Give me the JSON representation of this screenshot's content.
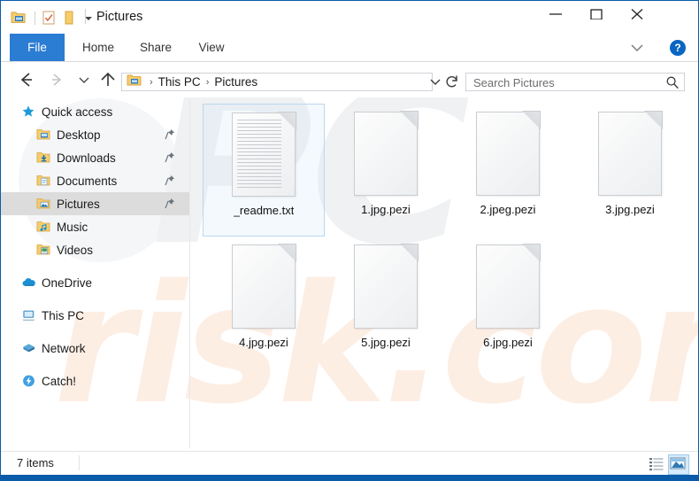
{
  "window": {
    "title": "Pictures",
    "quick_access_icons": [
      "folder-properties-icon",
      "properties-checkbox-icon",
      "new-folder-icon"
    ],
    "customize_qat_label": "Customize Quick Access Toolbar",
    "controls": {
      "minimize": "minimize-button",
      "maximize": "maximize-button",
      "close": "close-button"
    },
    "accent_color": "#0a5ca8",
    "file_tab_color": "#2b7cd3"
  },
  "ribbon": {
    "tabs": [
      {
        "label": "File",
        "active": true
      },
      {
        "label": "Home",
        "active": false
      },
      {
        "label": "Share",
        "active": false
      },
      {
        "label": "View",
        "active": false
      }
    ],
    "expand_label": "Expand Ribbon",
    "help_label": "?"
  },
  "address": {
    "back_label": "Back",
    "forward_label": "Forward",
    "recent_label": "Recent locations",
    "up_label": "Up one level",
    "breadcrumbs": [
      "This PC",
      "Pictures"
    ],
    "separator": "›",
    "dropdown_label": "Previous locations",
    "refresh_label": "Refresh",
    "search": {
      "placeholder": "Search Pictures",
      "value": ""
    }
  },
  "sidebar": {
    "items": [
      {
        "label": "Quick access",
        "icon": "star-icon",
        "indent": 0,
        "pinned": false,
        "selected": false,
        "gap_before": false
      },
      {
        "label": "Desktop",
        "icon": "folder-desktop-icon",
        "indent": 1,
        "pinned": true,
        "selected": false,
        "gap_before": false
      },
      {
        "label": "Downloads",
        "icon": "folder-downloads-icon",
        "indent": 1,
        "pinned": true,
        "selected": false,
        "gap_before": false
      },
      {
        "label": "Documents",
        "icon": "folder-documents-icon",
        "indent": 1,
        "pinned": true,
        "selected": false,
        "gap_before": false
      },
      {
        "label": "Pictures",
        "icon": "folder-pictures-icon",
        "indent": 1,
        "pinned": true,
        "selected": true,
        "gap_before": false
      },
      {
        "label": "Music",
        "icon": "folder-music-icon",
        "indent": 1,
        "pinned": false,
        "selected": false,
        "gap_before": false
      },
      {
        "label": "Videos",
        "icon": "folder-videos-icon",
        "indent": 1,
        "pinned": false,
        "selected": false,
        "gap_before": false
      },
      {
        "label": "OneDrive",
        "icon": "cloud-icon",
        "indent": 0,
        "pinned": false,
        "selected": false,
        "gap_before": true
      },
      {
        "label": "This PC",
        "icon": "computer-icon",
        "indent": 0,
        "pinned": false,
        "selected": false,
        "gap_before": true
      },
      {
        "label": "Network",
        "icon": "network-icon",
        "indent": 0,
        "pinned": false,
        "selected": false,
        "gap_before": true
      },
      {
        "label": "Catch!",
        "icon": "catch-icon",
        "indent": 0,
        "pinned": false,
        "selected": false,
        "gap_before": true
      }
    ]
  },
  "files": [
    {
      "name": "_readme.txt",
      "type": "text-document",
      "selected": true
    },
    {
      "name": "1.jpg.pezi",
      "type": "blank-document",
      "selected": false
    },
    {
      "name": "2.jpeg.pezi",
      "type": "blank-document",
      "selected": false
    },
    {
      "name": "3.jpg.pezi",
      "type": "blank-document",
      "selected": false
    },
    {
      "name": "4.jpg.pezi",
      "type": "blank-document",
      "selected": false
    },
    {
      "name": "5.jpg.pezi",
      "type": "blank-document",
      "selected": false
    },
    {
      "name": "6.jpg.pezi",
      "type": "blank-document",
      "selected": false
    }
  ],
  "status": {
    "count_text": "7 items",
    "view_details_label": "Details view",
    "view_large_label": "Large icons view",
    "active_view": "large-icons"
  },
  "watermark": {
    "part1": "PC",
    "part2": "risk.com",
    "color1": "#f0f1f3",
    "color2": "#fdeee4"
  }
}
